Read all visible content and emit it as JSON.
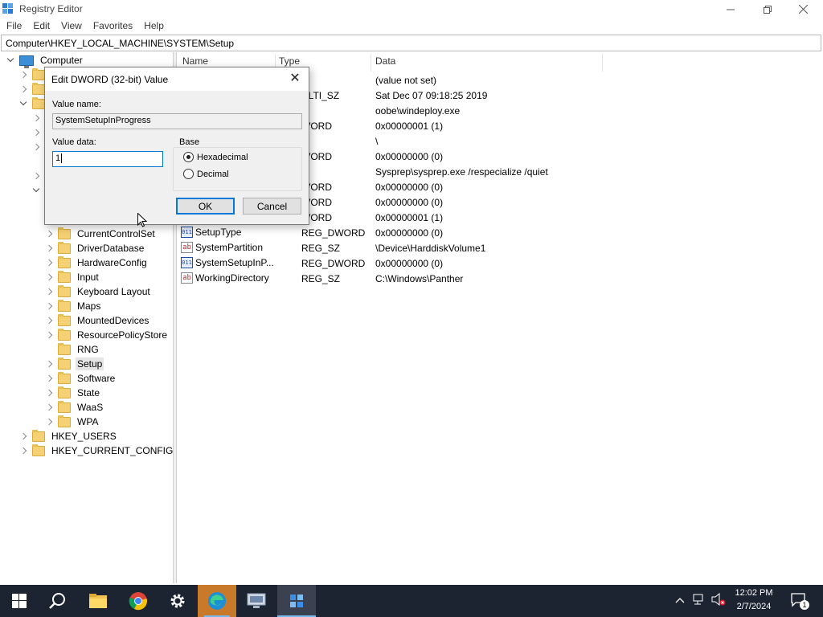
{
  "window": {
    "title": "Registry Editor"
  },
  "menu": [
    "File",
    "Edit",
    "View",
    "Favorites",
    "Help"
  ],
  "address": "Computer\\HKEY_LOCAL_MACHINE\\SYSTEM\\Setup",
  "tree": {
    "root": "Computer",
    "visible_items": [
      "CurrentControlSet",
      "DriverDatabase",
      "HardwareConfig",
      "Input",
      "Keyboard Layout",
      "Maps",
      "MountedDevices",
      "ResourcePolicyStore",
      "RNG",
      "Setup",
      "Software",
      "State",
      "WaaS",
      "WPA"
    ],
    "bottom_hives": [
      "HKEY_USERS",
      "HKEY_CURRENT_CONFIG"
    ],
    "selected": "Setup"
  },
  "list": {
    "columns": [
      "Name",
      "Type",
      "Data"
    ],
    "rows": [
      {
        "name": "",
        "type": "",
        "data": "(value not set)"
      },
      {
        "name": "",
        "type": "ULTI_SZ",
        "data": "Sat Dec 07 09:18:25 2019"
      },
      {
        "name": "",
        "type": "",
        "data": "oobe\\windeploy.exe"
      },
      {
        "name": "",
        "type": "WORD",
        "data": "0x00000001 (1)"
      },
      {
        "name": "",
        "type": "",
        "data": "\\"
      },
      {
        "name": "",
        "type": "WORD",
        "data": "0x00000000 (0)"
      },
      {
        "name": "",
        "type": "",
        "data": "Sysprep\\sysprep.exe /respecialize /quiet"
      },
      {
        "name": "",
        "type": "WORD",
        "data": "0x00000000 (0)"
      },
      {
        "name": "",
        "type": "WORD",
        "data": "0x00000000 (0)"
      },
      {
        "name": "",
        "type": "WORD",
        "data": "0x00000001 (1)"
      },
      {
        "name": "SetupType",
        "type": "REG_DWORD",
        "data": "0x00000000 (0)",
        "icon": "binary-value-icon"
      },
      {
        "name": "SystemPartition",
        "type": "REG_SZ",
        "data": "\\Device\\HarddiskVolume1",
        "icon": "string-value-icon"
      },
      {
        "name": "SystemSetupInP...",
        "type": "REG_DWORD",
        "data": "0x00000000 (0)",
        "icon": "binary-value-icon"
      },
      {
        "name": "WorkingDirectory",
        "type": "REG_SZ",
        "data": "C:\\Windows\\Panther",
        "icon": "string-value-icon"
      }
    ]
  },
  "dialog": {
    "title": "Edit DWORD (32-bit) Value",
    "close": "✕",
    "value_name_label": "Value name:",
    "value_name": "SystemSetupInProgress",
    "value_data_label": "Value data:",
    "value_data": "1",
    "base_label": "Base",
    "hex_label": "Hexadecimal",
    "dec_label": "Decimal",
    "base_selected": "Hexadecimal",
    "ok_label": "OK",
    "cancel_label": "Cancel"
  },
  "taskbar": {
    "apps": [
      "windows-start",
      "search",
      "file-explorer",
      "chrome",
      "settings",
      "edge",
      "remote-desktop",
      "registry-editor"
    ],
    "active": "registry-editor",
    "time": "12:02 PM",
    "date": "2/7/2024",
    "notification_count": "1"
  }
}
